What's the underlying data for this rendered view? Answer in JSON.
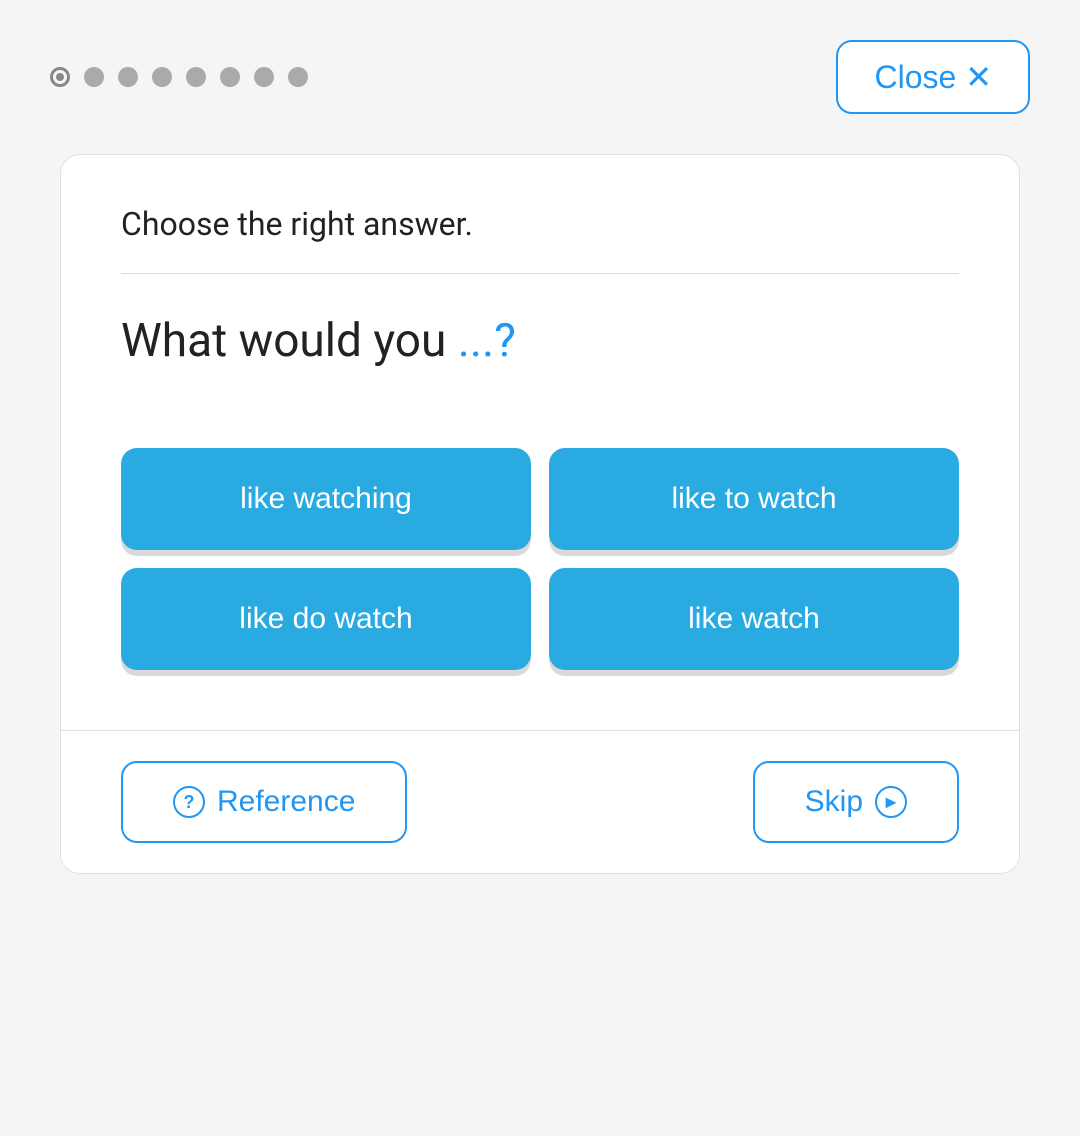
{
  "topbar": {
    "close_label": "Close ✕"
  },
  "progress": {
    "total_dots": 8,
    "active_index": 0
  },
  "card": {
    "instruction": "Choose the right answer.",
    "question_prefix": "What would you ",
    "question_blank": "...?",
    "answers": [
      {
        "id": "a1",
        "label": "like watching"
      },
      {
        "id": "a2",
        "label": "like to watch"
      },
      {
        "id": "a3",
        "label": "like do watch"
      },
      {
        "id": "a4",
        "label": "like watch"
      }
    ]
  },
  "footer": {
    "reference_label": "Reference",
    "skip_label": "Skip"
  }
}
